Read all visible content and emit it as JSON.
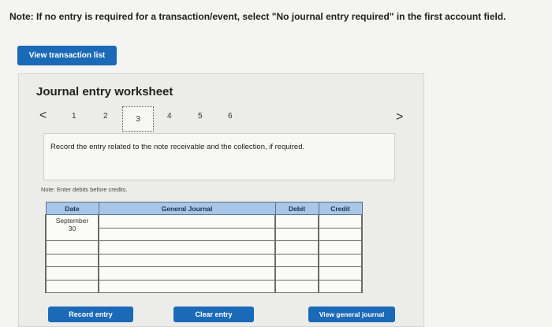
{
  "note": "Note: If no entry is required for a transaction/event, select \"No journal entry required\" in the first account field.",
  "buttons": {
    "view_transaction_list": "View transaction list",
    "record_entry": "Record entry",
    "clear_entry": "Clear entry",
    "view_general_journal": "View general journal"
  },
  "worksheet": {
    "title": "Journal entry worksheet",
    "prev_glyph": "<",
    "next_glyph": ">",
    "steps": [
      "1",
      "2",
      "3",
      "4",
      "5",
      "6"
    ],
    "active_step": 3,
    "instruction": "Record the entry related to the note receivable and the collection, if required.",
    "debits_note": "Note: Enter debits before credits."
  },
  "table": {
    "headers": {
      "date": "Date",
      "account": "General Journal",
      "debit": "Debit",
      "credit": "Credit"
    },
    "rows": [
      {
        "date_line1": "September",
        "date_line2": "30",
        "account": "",
        "debit": "",
        "credit": ""
      },
      {
        "date_line1": "",
        "date_line2": "",
        "account": "",
        "debit": "",
        "credit": ""
      },
      {
        "date_line1": "",
        "date_line2": "",
        "account": "",
        "debit": "",
        "credit": ""
      },
      {
        "date_line1": "",
        "date_line2": "",
        "account": "",
        "debit": "",
        "credit": ""
      },
      {
        "date_line1": "",
        "date_line2": "",
        "account": "",
        "debit": "",
        "credit": ""
      },
      {
        "date_line1": "",
        "date_line2": "",
        "account": "",
        "debit": "",
        "credit": ""
      }
    ]
  },
  "colors": {
    "button": "#1b6ab7",
    "table_header": "#a8c7e8"
  }
}
